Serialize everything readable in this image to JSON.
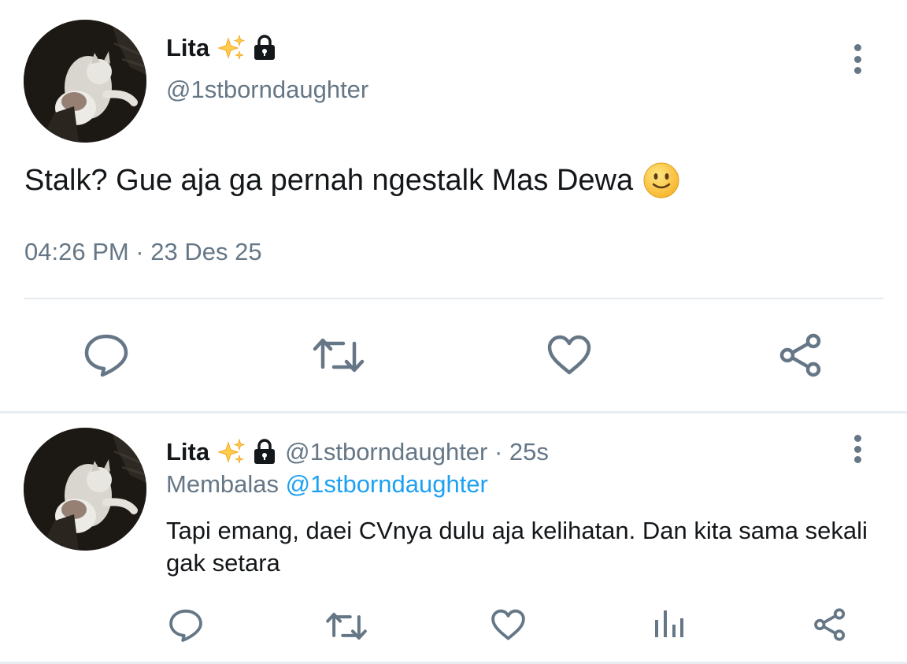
{
  "main_tweet": {
    "display_name": "Lita",
    "name_emoji_icon": "sparkles-icon",
    "protected_icon": "lock-icon",
    "handle": "@1stborndaughter",
    "text": "Stalk? Gue aja ga pernah ngestalk Mas Dewa",
    "text_emoji_icon": "slightly-smiling-face-icon",
    "timestamp": "04:26 PM · 23 Des 25",
    "actions": [
      "reply-icon",
      "retweet-icon",
      "like-icon",
      "share-icon"
    ]
  },
  "reply_tweet": {
    "display_name": "Lita",
    "handle_time": "@1stborndaughter · 25s",
    "replying_prefix": "Membalas",
    "replying_to": "@1stborndaughter",
    "text": "Tapi emang, daei CVnya dulu aja kelihatan. Dan kita sama sekali gak setara",
    "actions": [
      "reply-icon",
      "retweet-icon",
      "like-icon",
      "analytics-icon",
      "share-icon"
    ]
  },
  "colors": {
    "text_primary": "#14171a",
    "text_secondary": "#657786",
    "link": "#1da1f2",
    "icon": "#657786",
    "divider": "#e6ecf0"
  }
}
